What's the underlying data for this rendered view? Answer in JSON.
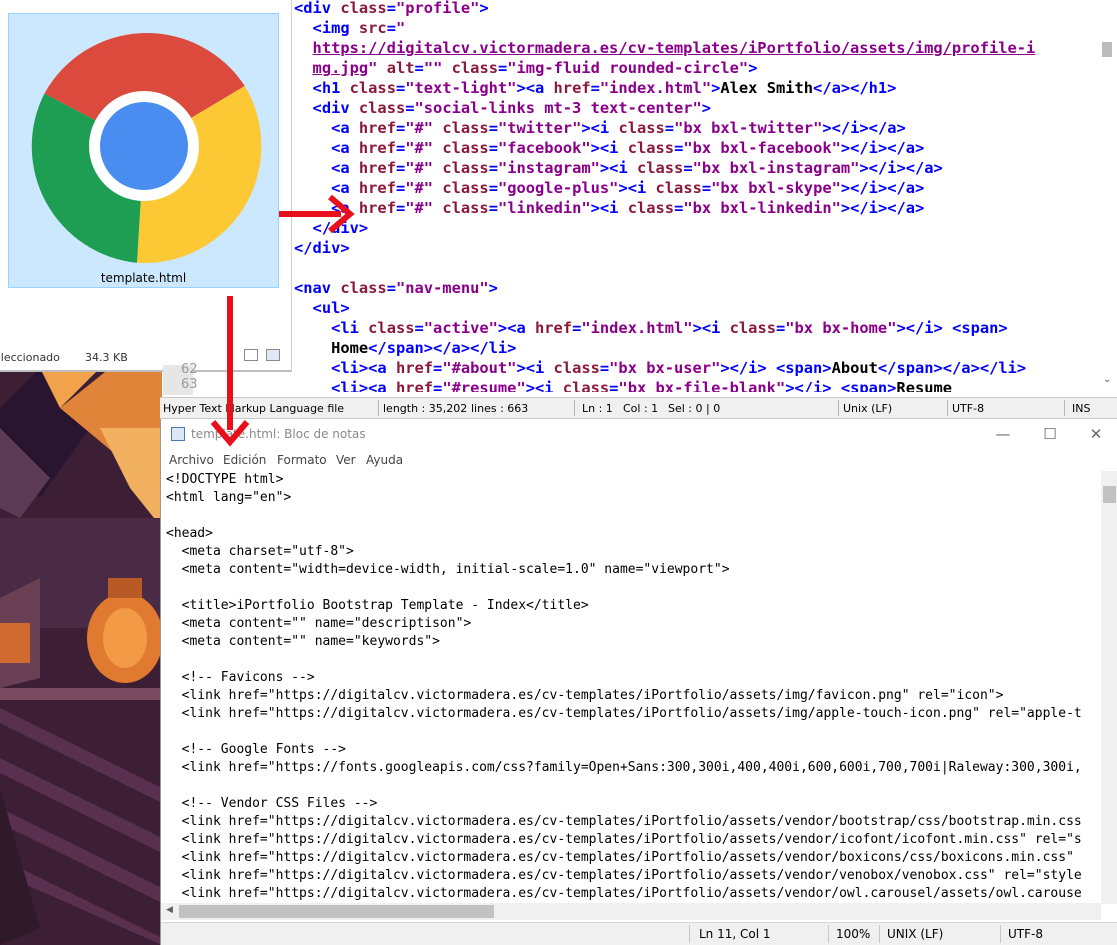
{
  "explorer": {
    "file_label": "template.html",
    "status_selected": "eleccionado",
    "status_size": "34.3 KB"
  },
  "editor": {
    "status": {
      "filetype": "Hyper Text Markup Language file",
      "length": "length : 35,202",
      "lines": "lines : 663",
      "ln": "Ln : 1",
      "col": "Col : 1",
      "sel": "Sel : 0 | 0",
      "eol": "Unix (LF)",
      "encoding": "UTF-8",
      "mode": "INS"
    },
    "gutter_lines": [
      "62",
      "63"
    ]
  },
  "notepad": {
    "title": "template.html: Bloc de notas",
    "menu": [
      "Archivo",
      "Edición",
      "Formato",
      "Ver",
      "Ayuda"
    ],
    "lines": [
      "<!DOCTYPE html>",
      "<html lang=\"en\">",
      "",
      "<head>",
      "  <meta charset=\"utf-8\">",
      "  <meta content=\"width=device-width, initial-scale=1.0\" name=\"viewport\">",
      "",
      "  <title>iPortfolio Bootstrap Template - Index</title>",
      "  <meta content=\"\" name=\"descriptison\">",
      "  <meta content=\"\" name=\"keywords\">",
      "",
      "  <!-- Favicons -->",
      "  <link href=\"https://digitalcv.victormadera.es/cv-templates/iPortfolio/assets/img/favicon.png\" rel=\"icon\">",
      "  <link href=\"https://digitalcv.victormadera.es/cv-templates/iPortfolio/assets/img/apple-touch-icon.png\" rel=\"apple-t",
      "",
      "  <!-- Google Fonts -->",
      "  <link href=\"https://fonts.googleapis.com/css?family=Open+Sans:300,300i,400,400i,600,600i,700,700i|Raleway:300,300i,",
      "",
      "  <!-- Vendor CSS Files -->",
      "  <link href=\"https://digitalcv.victormadera.es/cv-templates/iPortfolio/assets/vendor/bootstrap/css/bootstrap.min.css",
      "  <link href=\"https://digitalcv.victormadera.es/cv-templates/iPortfolio/assets/vendor/icofont/icofont.min.css\" rel=\"s",
      "  <link href=\"https://digitalcv.victormadera.es/cv-templates/iPortfolio/assets/vendor/boxicons/css/boxicons.min.css\"",
      "  <link href=\"https://digitalcv.victormadera.es/cv-templates/iPortfolio/assets/vendor/venobox/venobox.css\" rel=\"style",
      "  <link href=\"https://digitalcv.victormadera.es/cv-templates/iPortfolio/assets/vendor/owl.carousel/assets/owl.carouse"
    ],
    "status": {
      "position": "Ln 11, Col 1",
      "zoom": "100%",
      "eol": "UNIX (LF)",
      "encoding": "UTF-8"
    }
  },
  "colors": {
    "tag": "#0000ff",
    "attribute": "#8b1a3a",
    "value": "#8b008b",
    "arrow": "#e8101a",
    "selection": "#cce8ff"
  }
}
